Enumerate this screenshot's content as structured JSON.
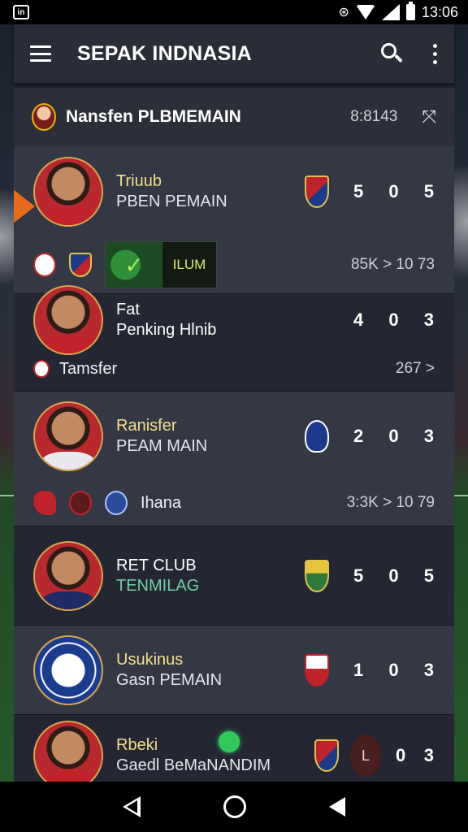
{
  "status_bar": {
    "time": "13:06",
    "left_icon": "app-notification-icon",
    "left_badge_text": "in"
  },
  "app_bar": {
    "title": "SEPAK INDNASIA",
    "menu_icon": "hamburger-menu-icon",
    "search_icon": "search-icon",
    "more_icon": "more-vertical-icon"
  },
  "subheader": {
    "title": "Nansfen PLBMEMAIN",
    "time": "8:8143",
    "expand_icon": "expand-icon"
  },
  "rows": [
    {
      "name_1": "Triuub",
      "name_2": "PBEN PEMAIN",
      "score": [
        "5",
        "0",
        "5"
      ],
      "sub_highlight_label": "ILUM",
      "sub_stat": "85K >  10 73"
    },
    {
      "name_1": "Fat",
      "name_2": "Penking Hlnib",
      "score": [
        "4",
        "0",
        "3"
      ],
      "sub_label": "Tamsfer",
      "sub_stat": "267 >"
    },
    {
      "name_1": "Ranisfer",
      "name_2": "PEAM MAIN",
      "score": [
        "2",
        "0",
        "3"
      ],
      "sub_label": "Ihana",
      "sub_stat": "3:3K >  10 79"
    },
    {
      "name_1": "RET CLUB",
      "name_2": "TENMILAG",
      "score": [
        "5",
        "0",
        "5"
      ]
    },
    {
      "name_1": "Usukinus",
      "name_2": "Gasn PEMAIN",
      "score": [
        "1",
        "0",
        "3"
      ]
    },
    {
      "name_1": "Rbeki",
      "name_2": "Gaedl BeMaNANDIM",
      "disc_label": "L",
      "score": [
        "0",
        "3"
      ]
    }
  ],
  "colors": {
    "accent_gold": "#f3df8a",
    "accent_green": "#6fcfa4",
    "status_dot": "#2fca5a",
    "highlight_tab": "#e86a1c"
  },
  "nav_bar": {
    "back_icon": "back-icon",
    "home_icon": "home-icon",
    "recent_icon": "recent-icon"
  }
}
